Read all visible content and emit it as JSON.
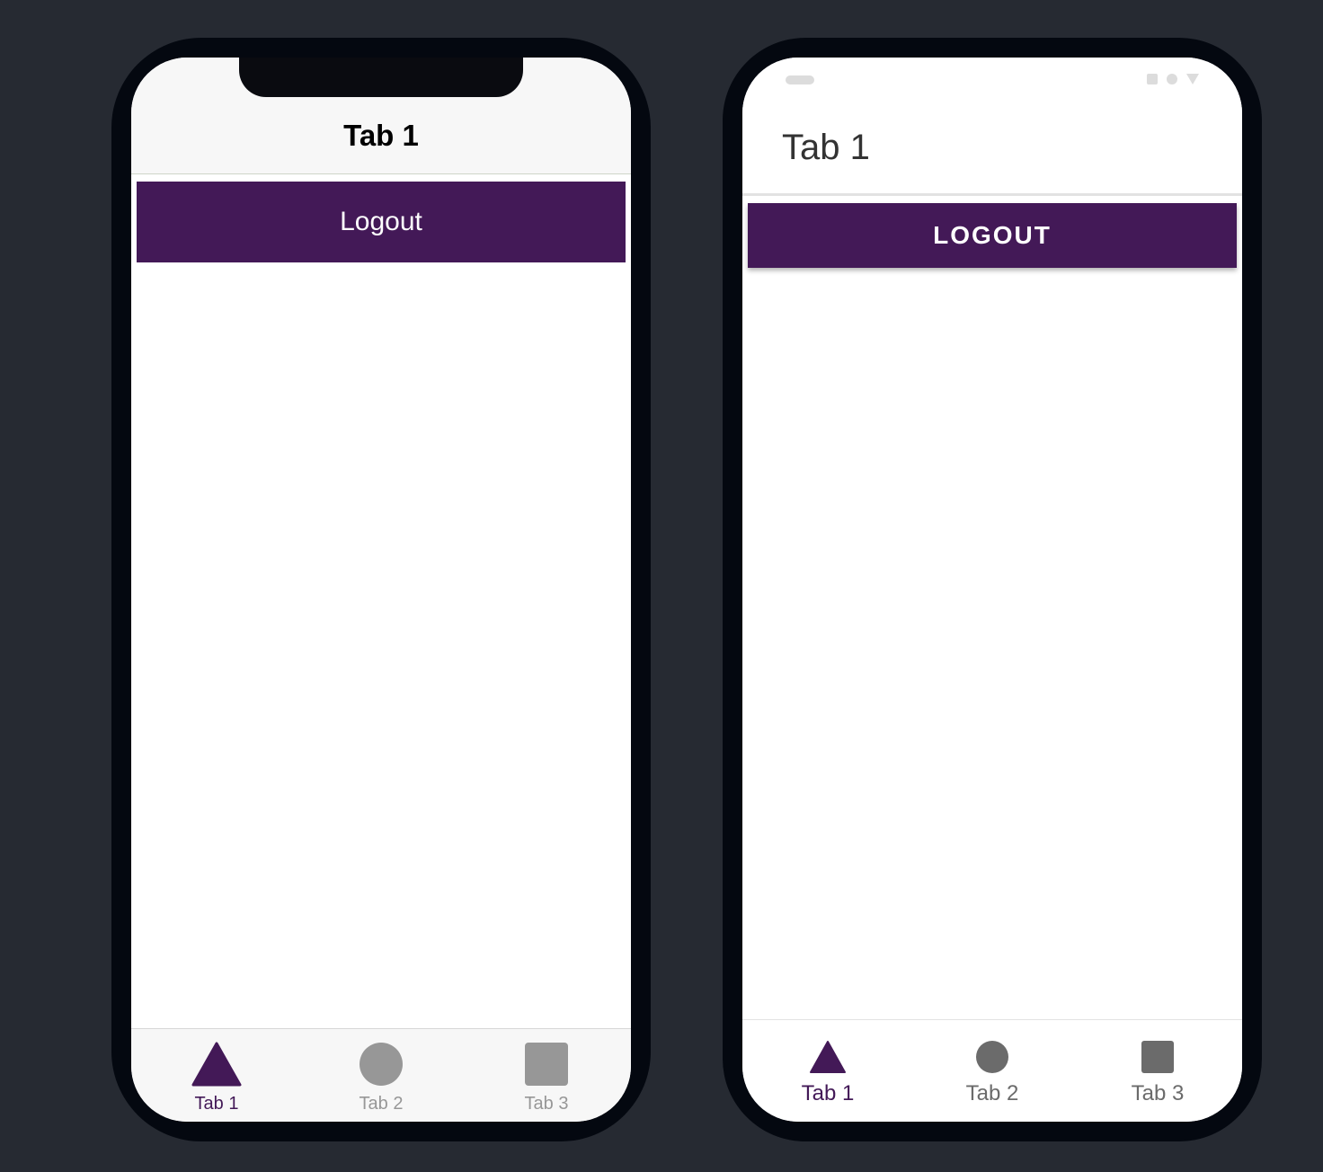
{
  "colors": {
    "background": "#262a32",
    "phone_bezel": "#040810",
    "primary": "#431957",
    "ios_tab_inactive": "#979797",
    "android_tab_inactive": "#6b6b6b"
  },
  "ios": {
    "header": {
      "title": "Tab 1"
    },
    "logout_label": "Logout",
    "tabs": [
      {
        "label": "Tab 1",
        "icon": "triangle-icon",
        "active": true
      },
      {
        "label": "Tab 2",
        "icon": "ellipse-icon",
        "active": false
      },
      {
        "label": "Tab 3",
        "icon": "square-icon",
        "active": false
      }
    ]
  },
  "android": {
    "header": {
      "title": "Tab 1"
    },
    "logout_label": "LOGOUT",
    "tabs": [
      {
        "label": "Tab 1",
        "icon": "triangle-icon",
        "active": true
      },
      {
        "label": "Tab 2",
        "icon": "ellipse-icon",
        "active": false
      },
      {
        "label": "Tab 3",
        "icon": "square-icon",
        "active": false
      }
    ]
  }
}
